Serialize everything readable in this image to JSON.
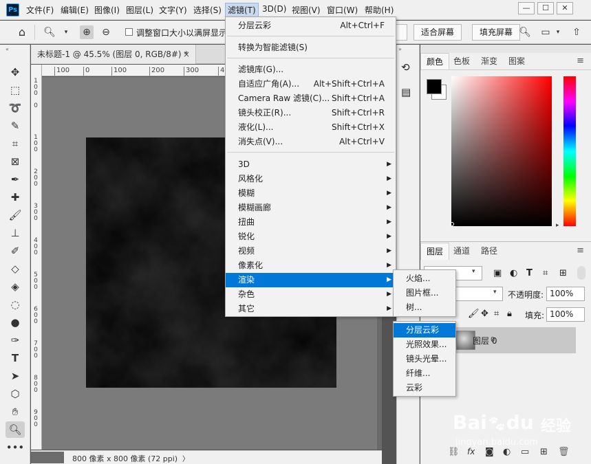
{
  "menubar": {
    "logo": "Ps",
    "items": [
      "文件(F)",
      "编辑(E)",
      "图像(I)",
      "图层(L)",
      "文字(Y)",
      "选择(S)",
      "滤镜(T)",
      "3D(D)",
      "视图(V)",
      "窗口(W)",
      "帮助(H)"
    ],
    "window_controls": [
      "—",
      "☐",
      "✕"
    ]
  },
  "options": {
    "checkbox_label": "调整窗口大小以满屏显示",
    "fit_screen": "适合屏幕",
    "fill_screen": "填充屏幕"
  },
  "document": {
    "tab_title": "未标题-1 @ 45.5% (图层 0, RGB/8#) *",
    "close": "×",
    "status_info": "800 像素 x 800 像素 (72 ppi)",
    "status_arrow": "〉"
  },
  "ruler": {
    "h_ticks": [
      "100",
      "0",
      "100",
      "200",
      "300",
      "400"
    ],
    "v_ticks": [
      "1\n0\n0",
      "0",
      "1\n0\n0",
      "2\n0\n0",
      "3\n0\n0",
      "4\n0\n0",
      "5\n0\n0",
      "6\n0\n0",
      "7\n0\n0",
      "8\n0\n0",
      "9\n0\n0"
    ]
  },
  "filter_menu": {
    "items": [
      {
        "label": "分层云彩",
        "shortcut": "Alt+Ctrl+F"
      },
      {
        "label": "转换为智能滤镜(S)",
        "shortcut": ""
      },
      {
        "label": "滤镜库(G)...",
        "shortcut": ""
      },
      {
        "label": "自适应广角(A)...",
        "shortcut": "Alt+Shift+Ctrl+A"
      },
      {
        "label": "Camera Raw 滤镜(C)...",
        "shortcut": "Shift+Ctrl+A"
      },
      {
        "label": "镜头校正(R)...",
        "shortcut": "Shift+Ctrl+R"
      },
      {
        "label": "液化(L)...",
        "shortcut": "Shift+Ctrl+X"
      },
      {
        "label": "消失点(V)...",
        "shortcut": "Alt+Ctrl+V"
      },
      {
        "label": "3D",
        "sub": true
      },
      {
        "label": "风格化",
        "sub": true
      },
      {
        "label": "模糊",
        "sub": true
      },
      {
        "label": "模糊画廊",
        "sub": true
      },
      {
        "label": "扭曲",
        "sub": true
      },
      {
        "label": "锐化",
        "sub": true
      },
      {
        "label": "视频",
        "sub": true
      },
      {
        "label": "像素化",
        "sub": true
      },
      {
        "label": "渲染",
        "sub": true,
        "highlight": true
      },
      {
        "label": "杂色",
        "sub": true
      },
      {
        "label": "其它",
        "sub": true
      }
    ]
  },
  "render_submenu": {
    "items": [
      "火焰...",
      "图片框...",
      "树..."
    ],
    "items2": [
      "分层云彩",
      "光照效果...",
      "镜头光晕...",
      "纤维...",
      "云彩"
    ],
    "highlight_index": 0
  },
  "panels": {
    "color_tabs": [
      "颜色",
      "色板",
      "渐变",
      "图案"
    ],
    "layer_tabs": [
      "图层",
      "通道",
      "路径"
    ],
    "opacity_label": "不透明度:",
    "opacity_value": "100%",
    "fill_label": "填充:",
    "fill_value": "100%",
    "layer_name": "图层 0",
    "layer_index": "0",
    "menu_icon": "≡"
  },
  "watermark": {
    "brand": "Bai",
    "brand2": "du",
    "cn": "经验",
    "url": "jingyan.baidu.com"
  }
}
